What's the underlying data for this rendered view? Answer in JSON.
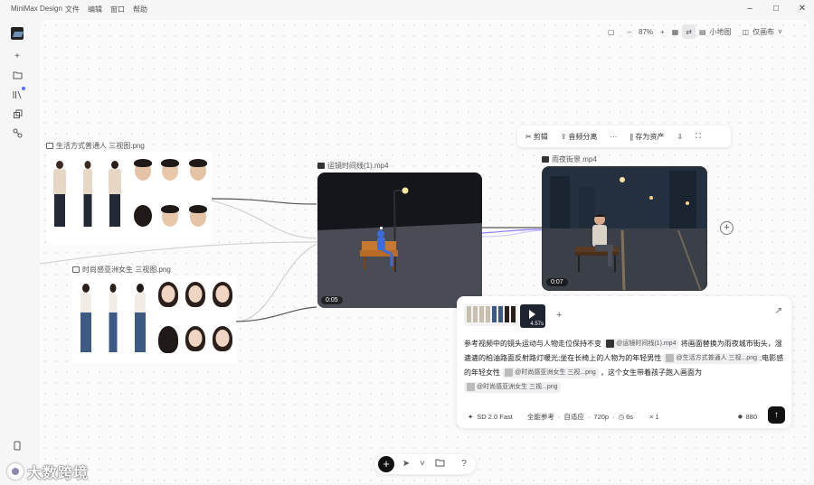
{
  "app": {
    "title": "MiniMax Design",
    "menus": [
      "文件",
      "编辑",
      "窗口",
      "帮助"
    ]
  },
  "window_controls": [
    "minimize",
    "maximize",
    "close"
  ],
  "sidebar": {
    "icons": [
      "logo",
      "add-icon",
      "folder-icon",
      "library-icon",
      "extension-icon",
      "share-icon",
      "phone-icon"
    ]
  },
  "topbar": {
    "zoom": "87%",
    "minimap_label": "小地图",
    "layout_label": "仅画布"
  },
  "nodes": {
    "man_sheet": {
      "label": "生活方式普通人 三视图.png"
    },
    "woman_sheet": {
      "label": "时尚感亚洲女生 三视图.png"
    },
    "storyboard_video": {
      "label": "运镜时间线(1).mp4",
      "time": "0:05"
    },
    "rain_video": {
      "label": "雨夜街景.mp4",
      "time": "0:07"
    }
  },
  "floating_toolbar": {
    "cut": "剪辑",
    "audio_split": "音频分离",
    "more": "···",
    "save_asset": "存为资产"
  },
  "prompt_panel": {
    "thumb_duration": "4.57s",
    "text_1": "参考视频中的镜头运动与人物走位保持不变",
    "chip_1": "@运镜时间线(1).mp4",
    "text_2": "将画面替换为雨夜城市街头，湿漉漉的柏油路面反射路灯暖光;坐在长椅上的人物为的年轻男性",
    "chip_2": "@生活方式普通人 三视...png",
    "text_3": ";电影感的年轻女性",
    "chip_3": "@时尚感亚洲女生 三视...png",
    "text_4": "，这个女生带着孩子跑入画面为",
    "chip_4": "@时尚感亚洲女生 三视...png",
    "model": "SD 2.0 Fast",
    "reference": "全能参考",
    "adapt": "自适应",
    "resolution": "720p",
    "duration": "6s",
    "count": "× 1",
    "credits": "880",
    "send_icon": "arrow-up-icon"
  },
  "watermark": {
    "text": "大数跨境"
  }
}
